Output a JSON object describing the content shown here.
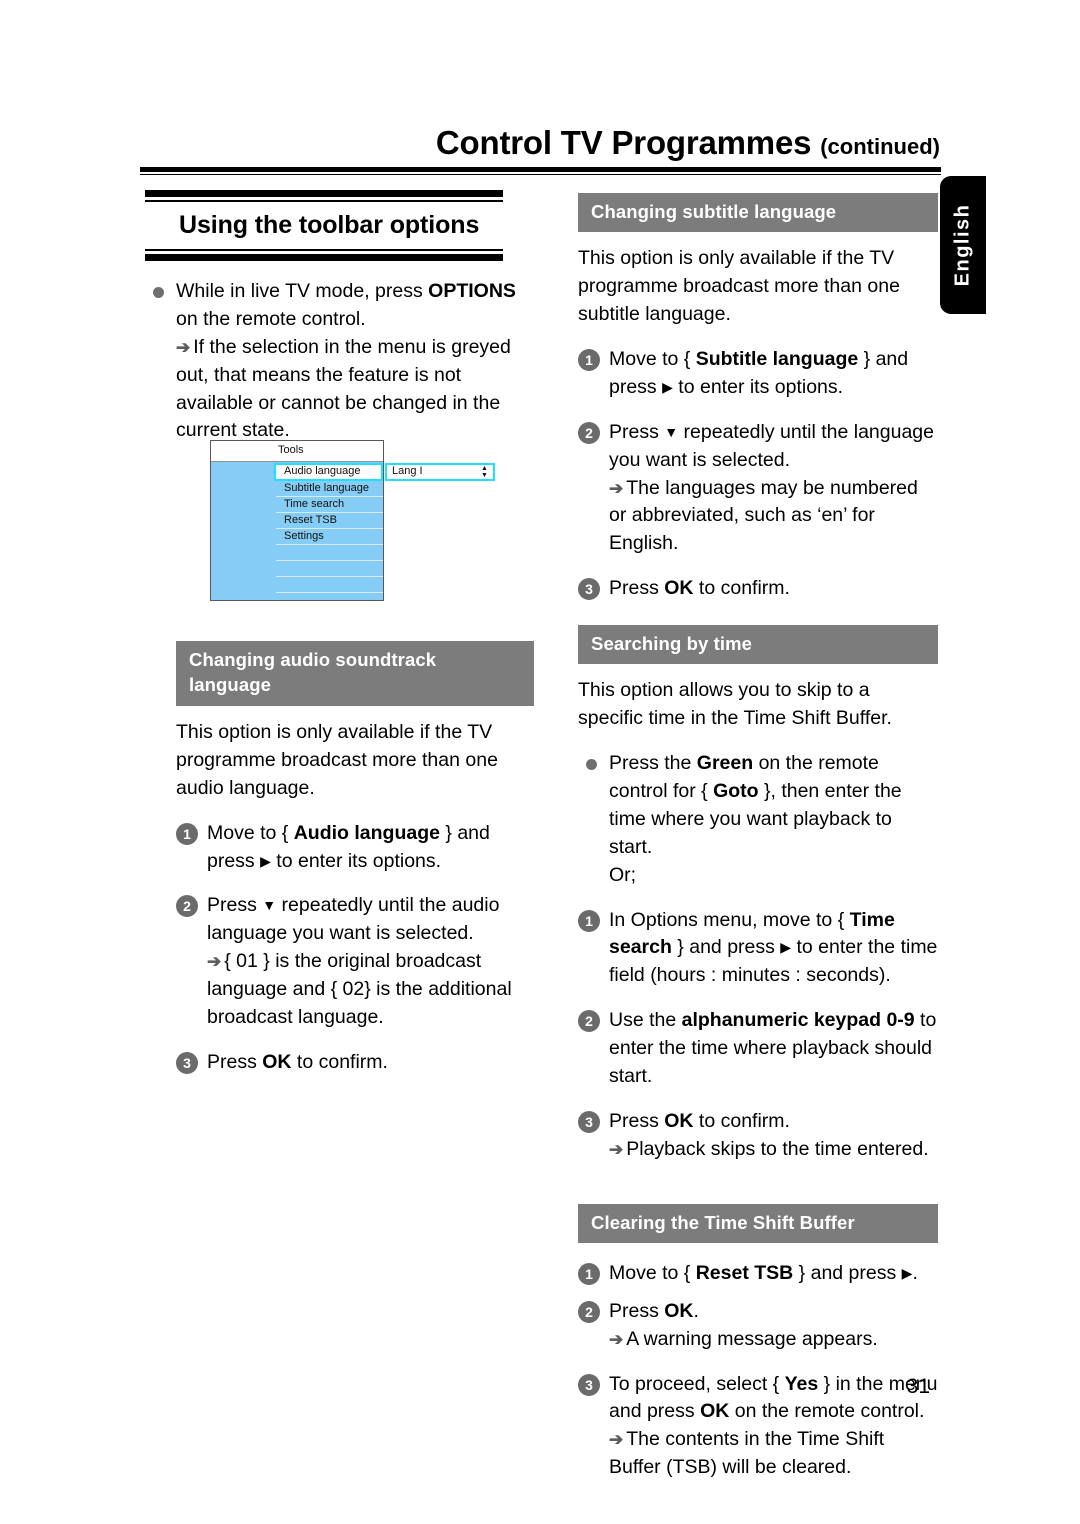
{
  "header": {
    "title": "Control TV Programmes",
    "continued": "(continued)"
  },
  "language_tab": "English",
  "page_number": "31",
  "left_column": {
    "main_heading": "Using the toolbar options",
    "bullet": {
      "line1_pre": "While in live TV mode, press ",
      "line1_bold": "OPTIONS",
      "line1_post": " on the remote control.",
      "arrow_note": "If the selection in the menu is greyed out, that means the feature is not available or cannot be changed in the current state."
    },
    "tv_screenshot": {
      "tools_label": "Tools",
      "items": [
        "Audio language",
        "Subtitle language",
        "Time search",
        "Reset TSB",
        "Settings"
      ],
      "selected_item": "Audio language",
      "selected_value": "Lang I",
      "spinner_up": "▲",
      "spinner_down": "▼",
      "colors": {
        "panel_blue": "#85cdf5",
        "highlight_cyan": "#1fe0ff",
        "row_divider": "#d6ecfb"
      }
    },
    "section": {
      "heading_line1": "Changing audio soundtrack",
      "heading_line2": "language",
      "intro": "This option is only available if the TV programme broadcast more than one audio language.",
      "steps": [
        {
          "num": "1",
          "pre": "Move to { ",
          "bold": "Audio language",
          "post": " } and press ",
          "arrow_glyph": "▶",
          "tail": " to enter its options."
        },
        {
          "num": "2",
          "pre": "Press ",
          "down_glyph": "▼",
          "post": " repeatedly until the audio language you want is selected.",
          "sub": "{ 01 } is the original broadcast language and { 02} is the additional broadcast language."
        },
        {
          "num": "3",
          "pre": "Press ",
          "bold": "OK",
          "post": " to confirm."
        }
      ]
    }
  },
  "right_column": {
    "section_subtitle": {
      "heading": "Changing subtitle language",
      "intro": "This option is only available if the TV programme broadcast more than one subtitle language.",
      "steps": [
        {
          "num": "1",
          "pre": "Move to { ",
          "bold": "Subtitle language",
          "post": " } and press ",
          "arrow_glyph": "▶",
          "tail": " to enter its options."
        },
        {
          "num": "2",
          "pre": "Press ",
          "down_glyph": "▼",
          "post": " repeatedly until the language you want is selected.",
          "sub": "The languages may be numbered or abbreviated, such as ‘en’ for English."
        },
        {
          "num": "3",
          "pre": "Press ",
          "bold": "OK",
          "post": " to confirm."
        }
      ]
    },
    "section_time": {
      "heading": "Searching by time",
      "intro": "This option allows you to skip to a specific time in the Time Shift Buffer.",
      "bullet": {
        "pre": "Press the ",
        "bold1": "Green",
        "mid": " on the remote control for { ",
        "bold2": "Goto",
        "post": " }, then enter the time where you want playback to start.",
        "or": "Or;"
      },
      "steps": [
        {
          "num": "1",
          "pre": "In Options menu, move to { ",
          "bold": "Time search",
          "post": " } and press ",
          "arrow_glyph": "▶",
          "tail": " to enter the time field (hours : minutes : seconds)."
        },
        {
          "num": "2",
          "pre": "Use the ",
          "bold": "alphanumeric keypad 0-9",
          "post": " to enter the time where playback should start."
        },
        {
          "num": "3",
          "pre": "Press ",
          "bold": "OK",
          "post": " to confirm.",
          "sub": "Playback skips to the time entered."
        }
      ]
    },
    "section_clear": {
      "heading": "Clearing the Time Shift Buffer",
      "steps": [
        {
          "num": "1",
          "pre": "Move to { ",
          "bold": "Reset TSB",
          "post": " } and press ",
          "arrow_glyph": "▶",
          "tail": "."
        },
        {
          "num": "2",
          "pre": "Press ",
          "bold": "OK",
          "post": ".",
          "sub": "A warning message appears."
        },
        {
          "num": "3",
          "pre": "To proceed, select { ",
          "bold": "Yes",
          "mid": " } in the menu and press ",
          "bold2": "OK",
          "post": " on the remote control.",
          "sub": "The contents in the Time Shift Buffer (TSB) will be cleared."
        }
      ]
    }
  },
  "glyphs": {
    "sub_arrow": "➔",
    "right_triangle": "▶",
    "down_triangle": "▼"
  }
}
